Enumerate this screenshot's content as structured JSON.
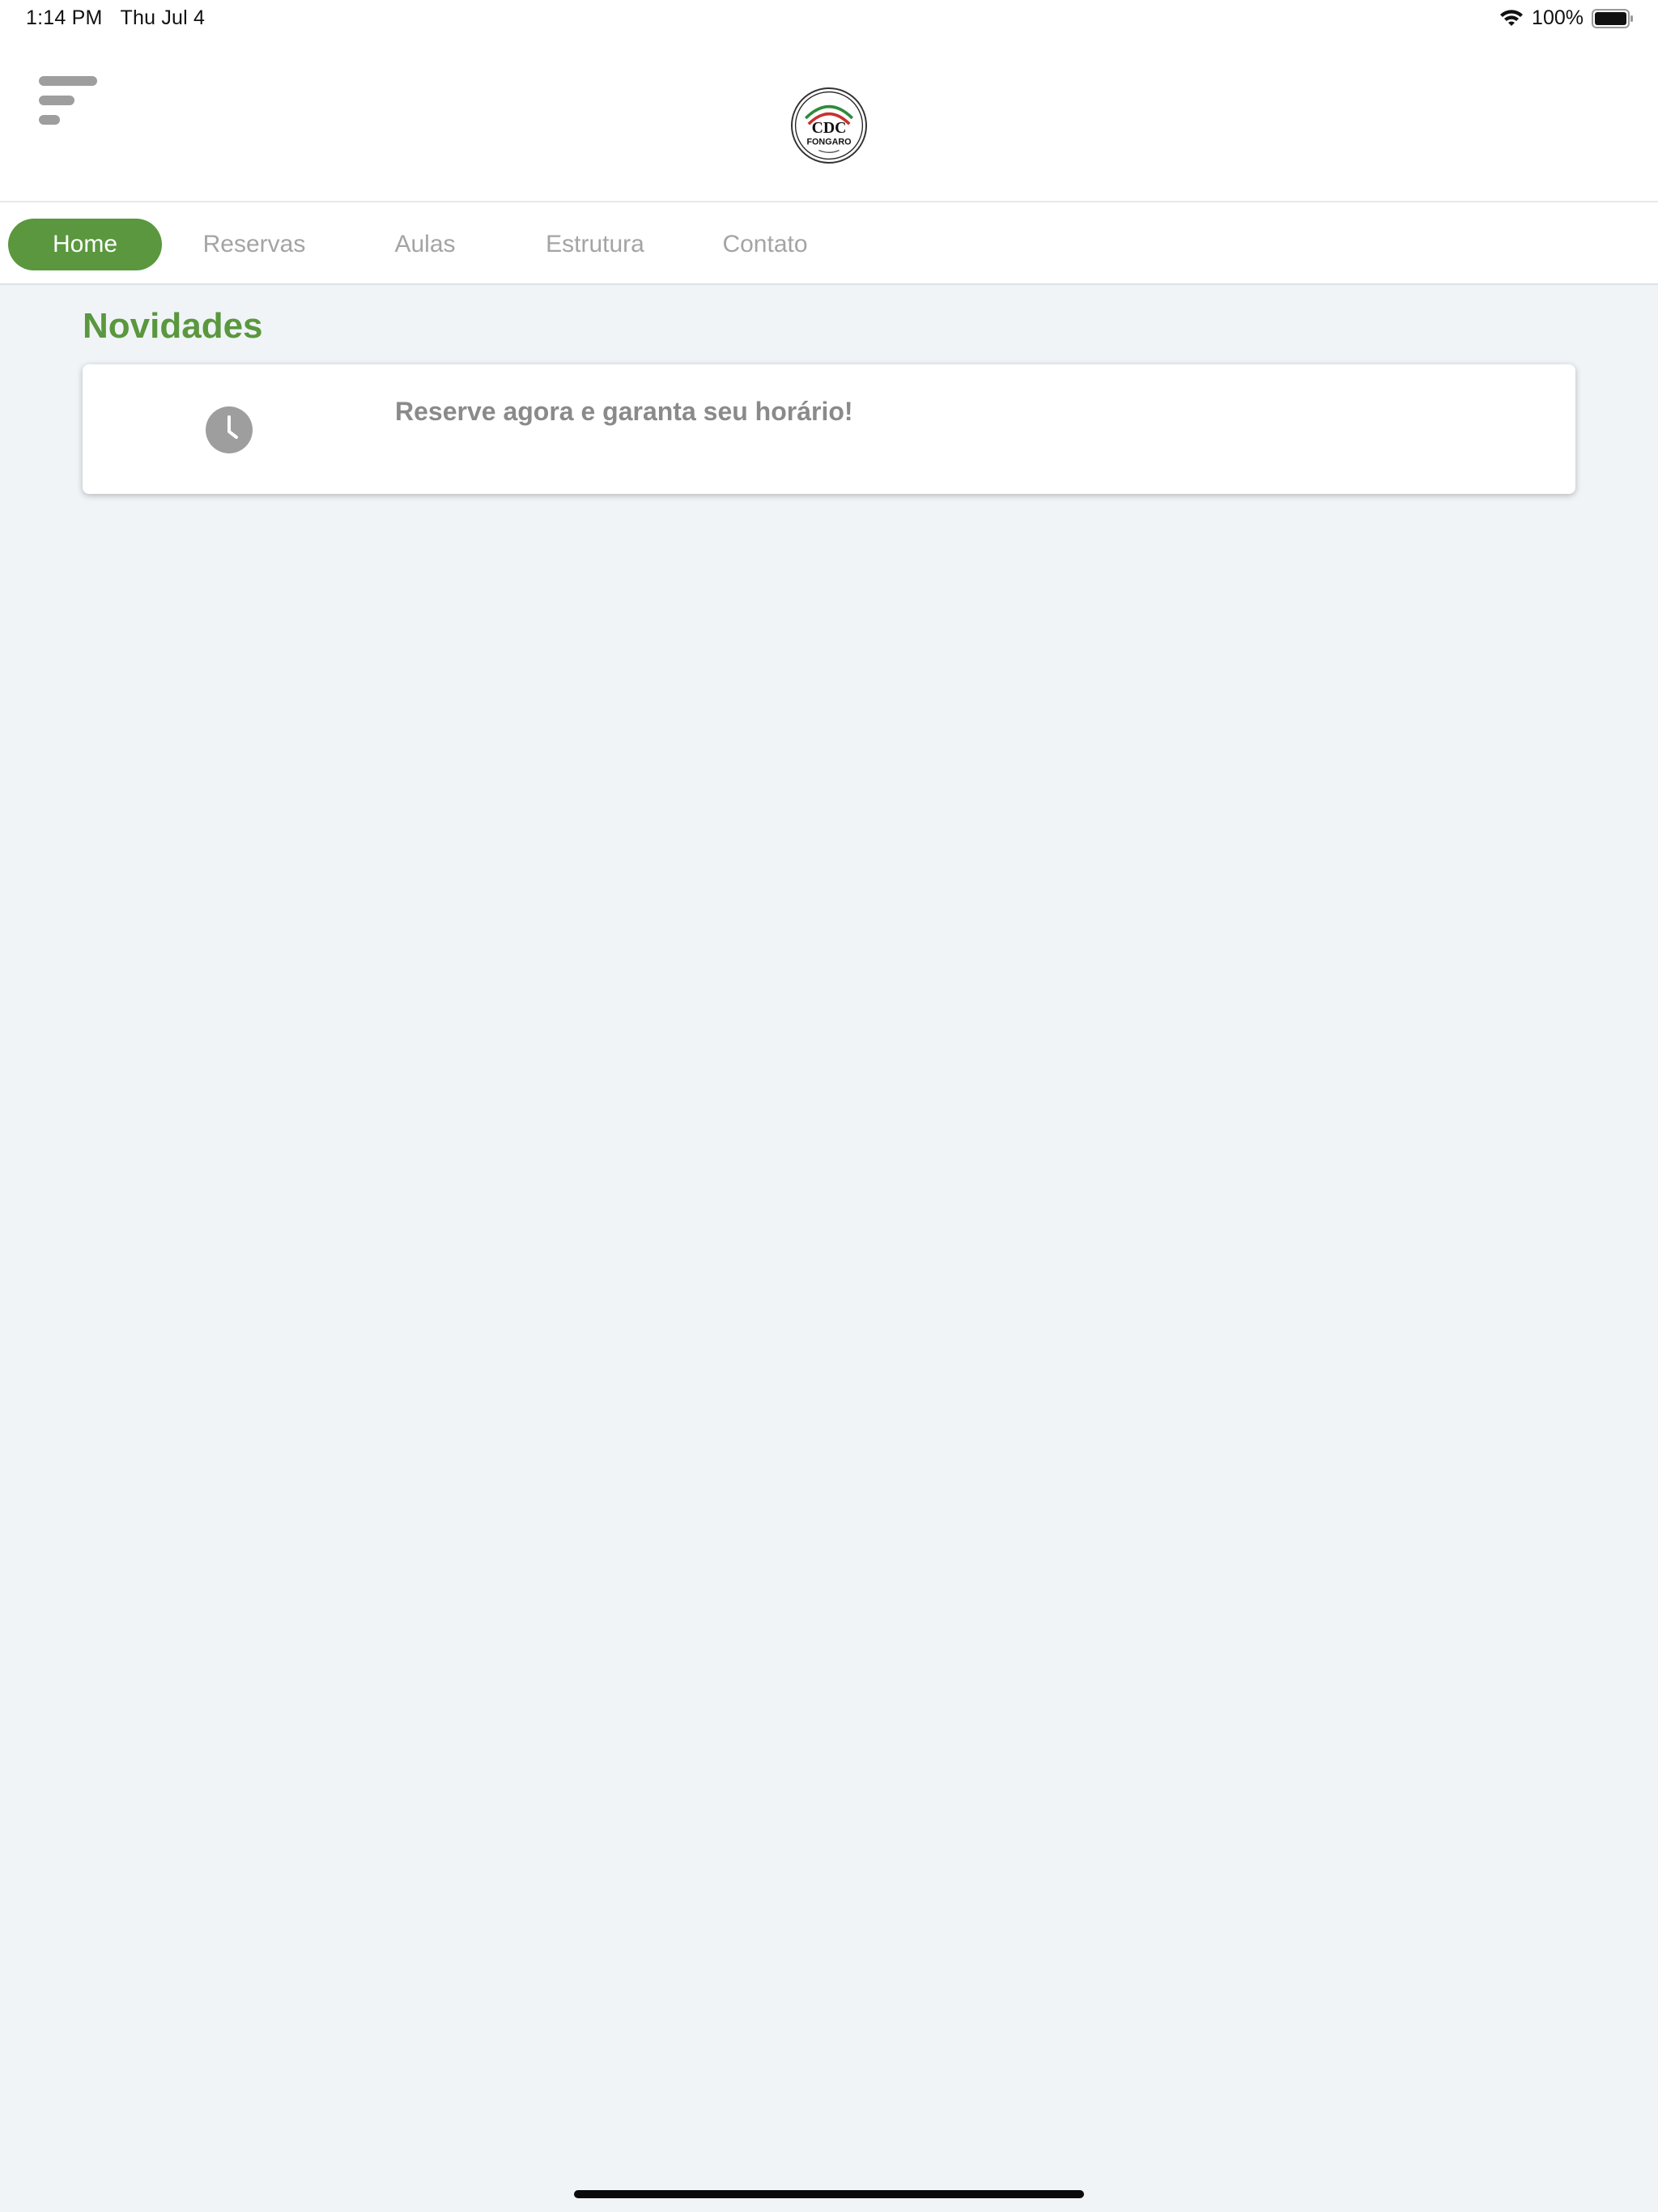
{
  "status_bar": {
    "time": "1:14 PM",
    "date": "Thu Jul 4",
    "battery_percent": "100%",
    "icons": [
      "wifi-icon",
      "battery-icon"
    ]
  },
  "header": {
    "menu_icon": "menu-icon",
    "logo_text": "FONGARO",
    "logo_monogram": "CDC"
  },
  "tabs": [
    {
      "label": "Home",
      "active": true
    },
    {
      "label": "Reservas",
      "active": false
    },
    {
      "label": "Aulas",
      "active": false
    },
    {
      "label": "Estrutura",
      "active": false
    },
    {
      "label": "Contato",
      "active": false
    }
  ],
  "news": {
    "title": "Novidades",
    "items": [
      {
        "icon": "clock-icon",
        "text": "Reserve agora e garanta seu horário!"
      }
    ]
  },
  "colors": {
    "accent": "#5a973e",
    "background": "#f0f4f7",
    "inactive_text": "#a4a4a4",
    "icon_gray": "#9e9e9e"
  }
}
